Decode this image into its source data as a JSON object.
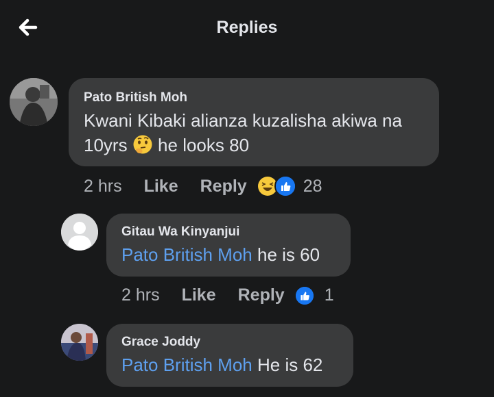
{
  "header": {
    "title": "Replies"
  },
  "comments": [
    {
      "author": "Pato British Moh",
      "text_before_emoji": "Kwani Kibaki alianza kuzalisha akiwa na 10yrs",
      "text_after_emoji": "he looks 80",
      "emoji": "thinking-face",
      "time": "2 hrs",
      "like_label": "Like",
      "reply_label": "Reply",
      "reactions": [
        "haha",
        "like"
      ],
      "reaction_count": "28"
    },
    {
      "author": "Gitau Wa Kinyanjui",
      "mention": "Pato British Moh",
      "text": "he is 60",
      "time": "2 hrs",
      "like_label": "Like",
      "reply_label": "Reply",
      "reactions": [
        "like"
      ],
      "reaction_count": "1"
    },
    {
      "author": "Grace Joddy",
      "mention": "Pato British Moh",
      "text": "He is 62"
    }
  ],
  "colors": {
    "background": "#18191a",
    "bubble": "#3a3b3c",
    "mention": "#5ea0ef",
    "meta": "#b0b3b8",
    "like_blue": "#1877f2",
    "haha_yellow": "#f7c93c"
  }
}
